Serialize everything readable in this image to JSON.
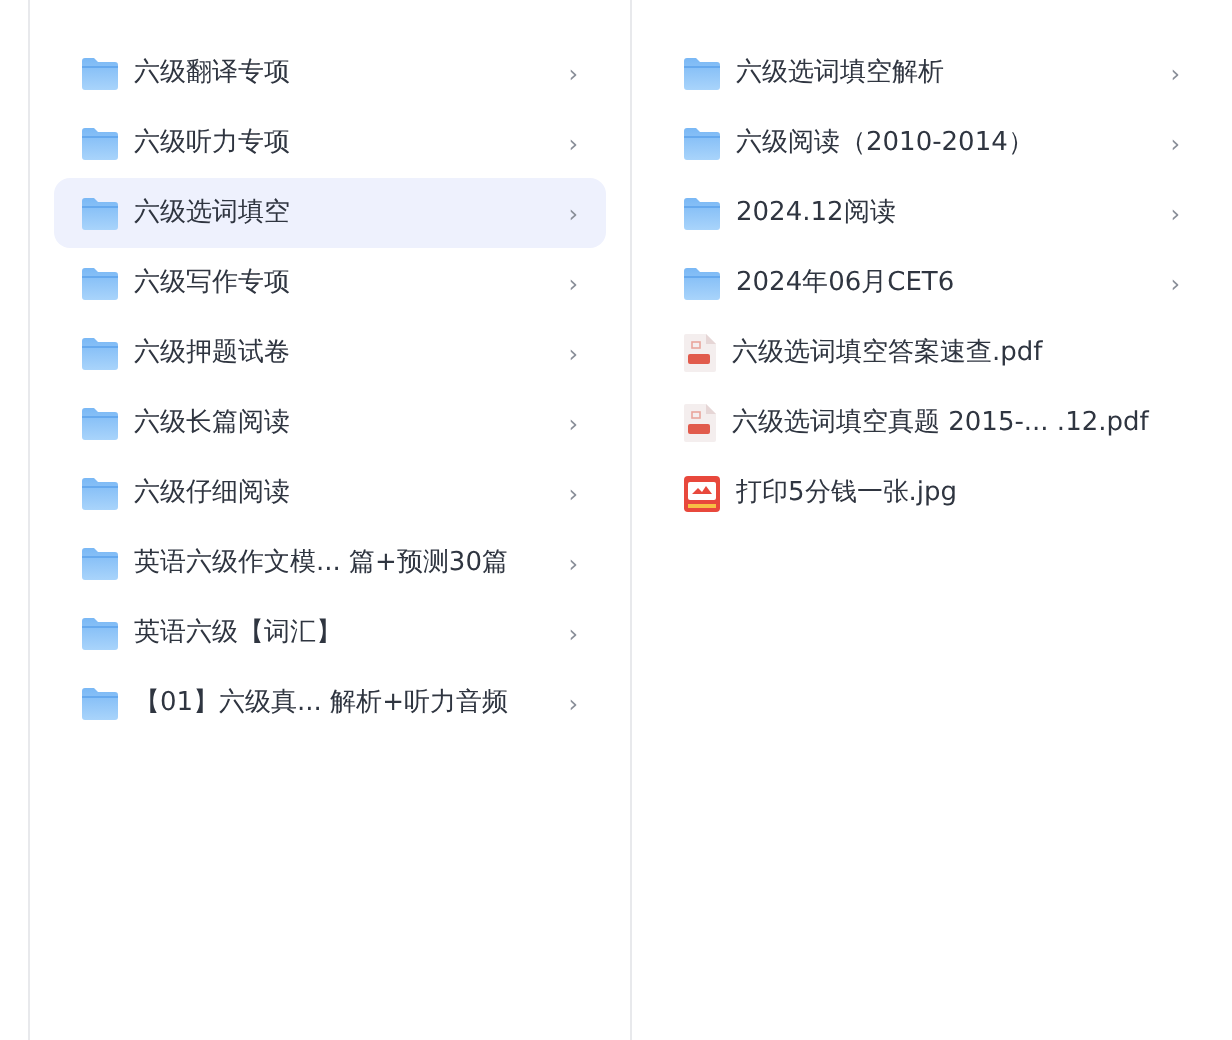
{
  "columns": [
    {
      "items": [
        {
          "kind": "folder",
          "name": "六级翻译专项",
          "chevron": "›",
          "selected": false
        },
        {
          "kind": "folder",
          "name": "六级听力专项",
          "chevron": "›",
          "selected": false
        },
        {
          "kind": "folder",
          "name": "六级选词填空",
          "chevron": "›",
          "selected": true
        },
        {
          "kind": "folder",
          "name": "六级写作专项",
          "chevron": "›",
          "selected": false
        },
        {
          "kind": "folder",
          "name": "六级押题试卷",
          "chevron": "›",
          "selected": false
        },
        {
          "kind": "folder",
          "name": "六级长篇阅读",
          "chevron": "›",
          "selected": false
        },
        {
          "kind": "folder",
          "name": "六级仔细阅读",
          "chevron": "›",
          "selected": false
        },
        {
          "kind": "folder",
          "name": "英语六级作文模... 篇+预测30篇",
          "chevron": "›",
          "selected": false
        },
        {
          "kind": "folder",
          "name": "英语六级【词汇】",
          "chevron": "›",
          "selected": false
        },
        {
          "kind": "folder",
          "name": "【01】六级真... 解析+听力音频",
          "chevron": "›",
          "selected": false
        }
      ]
    },
    {
      "items": [
        {
          "kind": "folder",
          "name": "六级选词填空解析",
          "chevron": "›",
          "selected": false
        },
        {
          "kind": "folder",
          "name": "六级阅读（2010-2014）",
          "chevron": "›",
          "selected": false
        },
        {
          "kind": "folder",
          "name": "2024.12阅读",
          "chevron": "›",
          "selected": false
        },
        {
          "kind": "folder",
          "name": "2024年06月CET6",
          "chevron": "›",
          "selected": false
        },
        {
          "kind": "pdf",
          "name": "六级选词填空答案速查.pdf",
          "selected": false
        },
        {
          "kind": "pdf",
          "name": "六级选词填空真题 2015-... .12.pdf",
          "selected": false
        },
        {
          "kind": "image",
          "name": "打印5分钱一张.jpg",
          "selected": false
        }
      ]
    }
  ]
}
